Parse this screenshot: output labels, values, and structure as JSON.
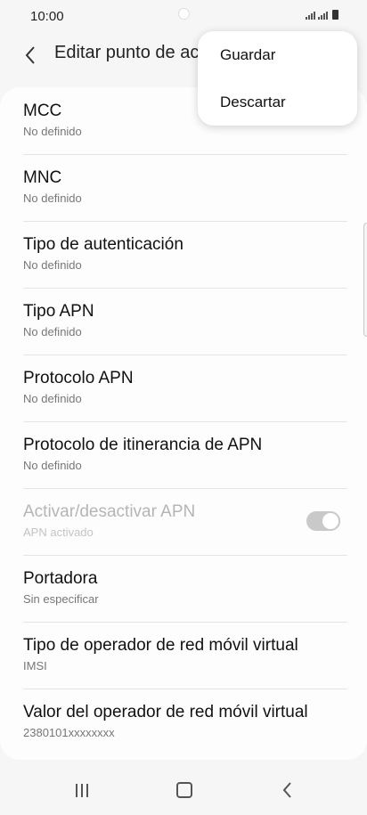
{
  "status_bar": {
    "time": "10:00"
  },
  "app_bar": {
    "title": "Editar punto de acceso"
  },
  "menu": {
    "save": "Guardar",
    "discard": "Descartar"
  },
  "settings": [
    {
      "title": "MCC",
      "subtitle": "No definido"
    },
    {
      "title": "MNC",
      "subtitle": "No definido"
    },
    {
      "title": "Tipo de autenticación",
      "subtitle": "No definido"
    },
    {
      "title": "Tipo APN",
      "subtitle": "No definido"
    },
    {
      "title": "Protocolo APN",
      "subtitle": "No definido"
    },
    {
      "title": "Protocolo de itinerancia de APN",
      "subtitle": "No definido"
    },
    {
      "title": "Activar/desactivar APN",
      "subtitle": "APN activado",
      "toggle_on": true,
      "disabled": true
    },
    {
      "title": "Portadora",
      "subtitle": "Sin especificar"
    },
    {
      "title": "Tipo de operador de red móvil virtual",
      "subtitle": "IMSI"
    },
    {
      "title": "Valor del operador de red móvil virtual",
      "subtitle": "2380101xxxxxxxx"
    }
  ],
  "icons": {
    "back": "chevron-left-icon",
    "nav_recents": "recents-icon",
    "nav_home": "home-icon",
    "nav_back": "back-icon"
  }
}
